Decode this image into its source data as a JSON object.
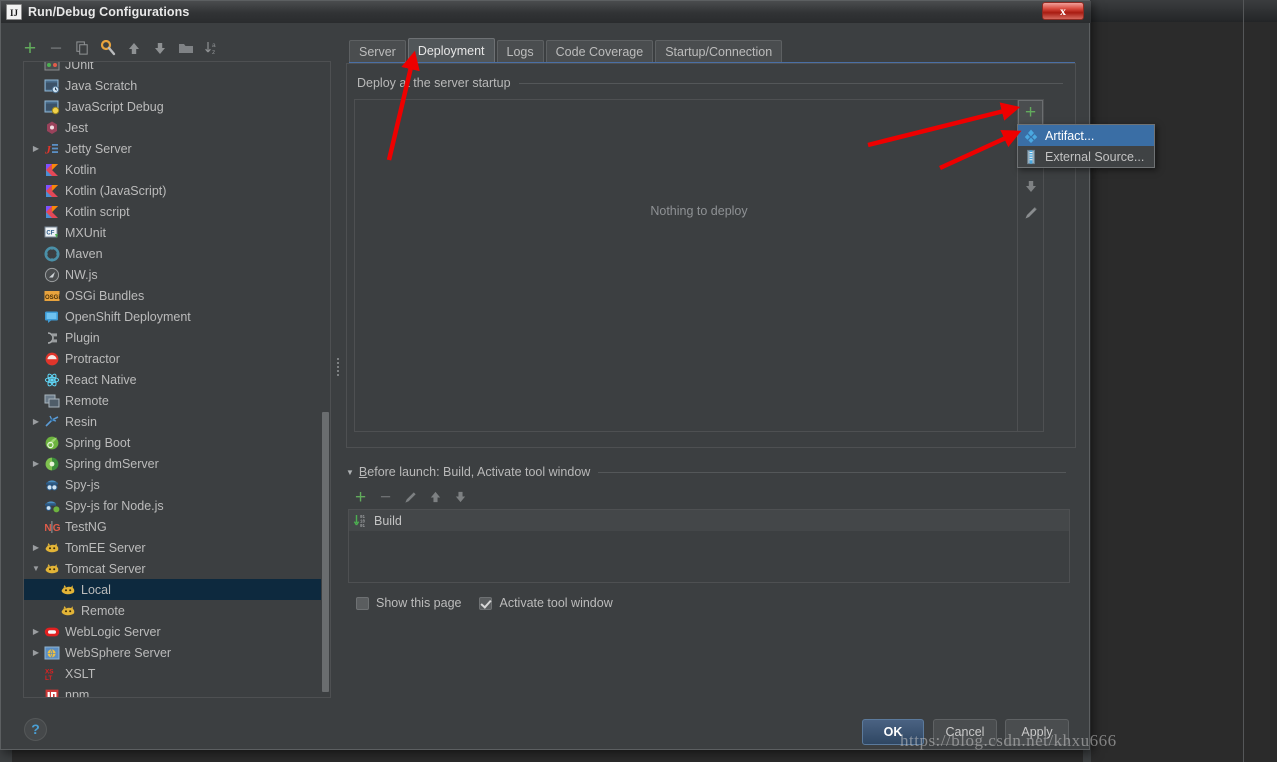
{
  "window": {
    "title": "Run/Debug Configurations",
    "app_icon": "IJ",
    "close_label": "x"
  },
  "left_toolbar": {
    "buttons": [
      {
        "name": "add-configuration",
        "icon": "plus-icon",
        "glyph": "+"
      },
      {
        "name": "remove-configuration",
        "icon": "minus-icon",
        "glyph": "−"
      },
      {
        "name": "copy-configuration",
        "icon": "copy-icon",
        "glyph": ""
      },
      {
        "name": "edit-defaults",
        "icon": "wrench-icon",
        "glyph": ""
      },
      {
        "name": "move-up",
        "icon": "arrow-up-icon",
        "glyph": "↑"
      },
      {
        "name": "move-down",
        "icon": "arrow-down-icon",
        "glyph": "↓"
      },
      {
        "name": "create-folder",
        "icon": "folder-icon",
        "glyph": ""
      },
      {
        "name": "sort-configurations",
        "icon": "sort-az-icon",
        "glyph": "↓"
      }
    ]
  },
  "tree": {
    "items": [
      {
        "label": "JUnit",
        "icon": "junit-icon",
        "twisty": "",
        "indent": 1,
        "selected": false,
        "partial": true
      },
      {
        "label": "Java Scratch",
        "icon": "java-scratch-icon",
        "twisty": "",
        "indent": 1,
        "selected": false
      },
      {
        "label": "JavaScript Debug",
        "icon": "javascript-debug-icon",
        "twisty": "",
        "indent": 1,
        "selected": false
      },
      {
        "label": "Jest",
        "icon": "jest-icon",
        "twisty": "",
        "indent": 1,
        "selected": false
      },
      {
        "label": "Jetty Server",
        "icon": "jetty-icon",
        "twisty": "▶",
        "indent": 0,
        "selected": false
      },
      {
        "label": "Kotlin",
        "icon": "kotlin-icon",
        "twisty": "",
        "indent": 1,
        "selected": false
      },
      {
        "label": "Kotlin (JavaScript)",
        "icon": "kotlin-icon",
        "twisty": "",
        "indent": 1,
        "selected": false
      },
      {
        "label": "Kotlin script",
        "icon": "kotlin-icon",
        "twisty": "",
        "indent": 1,
        "selected": false
      },
      {
        "label": "MXUnit",
        "icon": "mxunit-icon",
        "twisty": "",
        "indent": 1,
        "selected": false
      },
      {
        "label": "Maven",
        "icon": "maven-icon",
        "twisty": "",
        "indent": 1,
        "selected": false
      },
      {
        "label": "NW.js",
        "icon": "nwjs-icon",
        "twisty": "",
        "indent": 1,
        "selected": false
      },
      {
        "label": "OSGi Bundles",
        "icon": "osgi-icon",
        "twisty": "",
        "indent": 1,
        "selected": false
      },
      {
        "label": "OpenShift Deployment",
        "icon": "openshift-icon",
        "twisty": "",
        "indent": 1,
        "selected": false
      },
      {
        "label": "Plugin",
        "icon": "plugin-icon",
        "twisty": "",
        "indent": 1,
        "selected": false
      },
      {
        "label": "Protractor",
        "icon": "protractor-icon",
        "twisty": "",
        "indent": 1,
        "selected": false
      },
      {
        "label": "React Native",
        "icon": "react-native-icon",
        "twisty": "",
        "indent": 1,
        "selected": false
      },
      {
        "label": "Remote",
        "icon": "remote-icon",
        "twisty": "",
        "indent": 1,
        "selected": false
      },
      {
        "label": "Resin",
        "icon": "resin-icon",
        "twisty": "▶",
        "indent": 0,
        "selected": false
      },
      {
        "label": "Spring Boot",
        "icon": "spring-boot-icon",
        "twisty": "",
        "indent": 1,
        "selected": false
      },
      {
        "label": "Spring dmServer",
        "icon": "spring-dmserver-icon",
        "twisty": "▶",
        "indent": 0,
        "selected": false
      },
      {
        "label": "Spy-js",
        "icon": "spy-js-icon",
        "twisty": "",
        "indent": 1,
        "selected": false
      },
      {
        "label": "Spy-js for Node.js",
        "icon": "spy-js-node-icon",
        "twisty": "",
        "indent": 1,
        "selected": false
      },
      {
        "label": "TestNG",
        "icon": "testng-icon",
        "twisty": "",
        "indent": 1,
        "selected": false
      },
      {
        "label": "TomEE Server",
        "icon": "tomee-icon",
        "twisty": "▶",
        "indent": 0,
        "selected": false
      },
      {
        "label": "Tomcat Server",
        "icon": "tomcat-icon",
        "twisty": "▼",
        "indent": 0,
        "selected": false
      },
      {
        "label": "Local",
        "icon": "tomcat-icon",
        "twisty": "",
        "indent": 2,
        "selected": true
      },
      {
        "label": "Remote",
        "icon": "tomcat-icon",
        "twisty": "",
        "indent": 2,
        "selected": false
      },
      {
        "label": "WebLogic Server",
        "icon": "weblogic-icon",
        "twisty": "▶",
        "indent": 0,
        "selected": false
      },
      {
        "label": "WebSphere Server",
        "icon": "websphere-icon",
        "twisty": "▶",
        "indent": 0,
        "selected": false
      },
      {
        "label": "XSLT",
        "icon": "xslt-icon",
        "twisty": "",
        "indent": 1,
        "selected": false
      },
      {
        "label": "npm",
        "icon": "npm-icon",
        "twisty": "",
        "indent": 1,
        "selected": false
      }
    ]
  },
  "tabs": [
    {
      "label": "Server",
      "active": false
    },
    {
      "label": "Deployment",
      "active": true
    },
    {
      "label": "Logs",
      "active": false
    },
    {
      "label": "Code Coverage",
      "active": false
    },
    {
      "label": "Startup/Connection",
      "active": false
    }
  ],
  "deployment": {
    "legend": "Deploy at the server startup",
    "empty_text": "Nothing to deploy",
    "add_button_glyph": "+",
    "down_button_glyph": "↓",
    "edit_button_icon": "pencil-icon"
  },
  "popup_menu": {
    "items": [
      {
        "label": "Artifact...",
        "icon": "artifact-icon",
        "highlighted": true
      },
      {
        "label": "External Source...",
        "icon": "external-source-icon",
        "highlighted": false
      }
    ]
  },
  "before_launch": {
    "legend_prefix": "B",
    "legend_rest": "efore launch: Build, Activate tool window",
    "twisty": "▼",
    "toolbar": [
      {
        "name": "add-task",
        "icon": "plus-icon",
        "glyph": "+"
      },
      {
        "name": "remove-task",
        "icon": "minus-icon",
        "glyph": "−"
      },
      {
        "name": "edit-task",
        "icon": "pencil-icon",
        "glyph": ""
      },
      {
        "name": "move-task-up",
        "icon": "arrow-up-icon",
        "glyph": "↑"
      },
      {
        "name": "move-task-down",
        "icon": "arrow-down-icon",
        "glyph": "↓"
      }
    ],
    "tasks": [
      {
        "label": "Build",
        "icon": "build-icon"
      }
    ]
  },
  "checkboxes": [
    {
      "label": "Show this page",
      "checked": false
    },
    {
      "label": "Activate tool window",
      "checked": true
    }
  ],
  "dialog_buttons": {
    "ok": "OK",
    "cancel": "Cancel",
    "apply": "Apply"
  },
  "help": {
    "glyph": "?"
  },
  "watermark": "https://blog.csdn.net/khxu666",
  "colors": {
    "dialog_bg": "#3c3f41",
    "selection_blue": "#0d293e",
    "menu_highlight": "#3a6ea5",
    "accent_green": "#62ab5c",
    "tab_underline": "#4a6fa5",
    "annotation_red": "#ee0000"
  }
}
